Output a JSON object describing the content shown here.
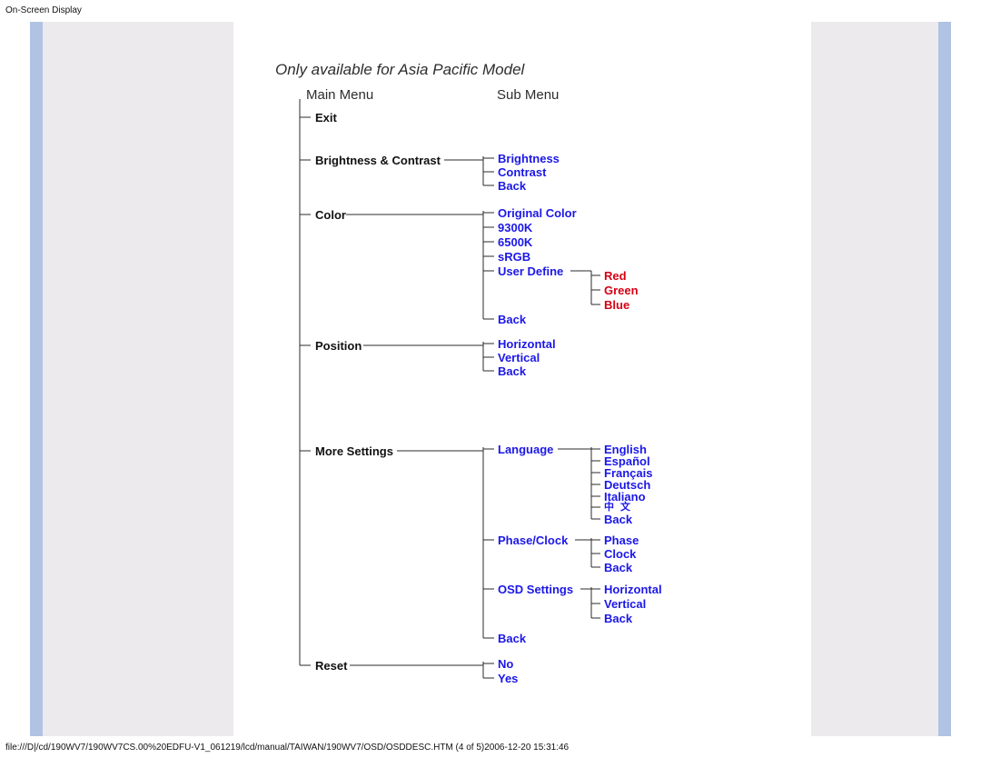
{
  "header": "On-Screen Display",
  "footer": "file:///D|/cd/190WV7/190WV7CS.00%20EDFU-V1_061219/lcd/manual/TAIWAN/190WV7/OSD/OSDDESC.HTM (4 of 5)2006-12-20 15:31:46",
  "title": "Only available for Asia Pacific Model",
  "col_main": "Main Menu",
  "col_sub": "Sub Menu",
  "main": {
    "exit": "Exit",
    "brightness_contrast": "Brightness & Contrast",
    "color": "Color",
    "position": "Position",
    "more_settings": "More Settings",
    "reset": "Reset"
  },
  "sub": {
    "brightness": "Brightness",
    "contrast": "Contrast",
    "back": "Back",
    "original_color": "Original Color",
    "k9300": "9300K",
    "k6500": "6500K",
    "srgb": "sRGB",
    "user_define": "User Define",
    "horizontal": "Horizontal",
    "vertical": "Vertical",
    "language": "Language",
    "phase_clock": "Phase/Clock",
    "osd_settings": "OSD Settings",
    "no": "No",
    "yes": "Yes"
  },
  "third": {
    "red": "Red",
    "green": "Green",
    "blue": "Blue",
    "english": "English",
    "espanol": "Español",
    "francais": "Français",
    "deutsch": "Deutsch",
    "italiano": "Italiano",
    "chinese": "中 文",
    "back": "Back",
    "phase": "Phase",
    "clock": "Clock",
    "horizontal": "Horizontal",
    "vertical": "Vertical"
  }
}
